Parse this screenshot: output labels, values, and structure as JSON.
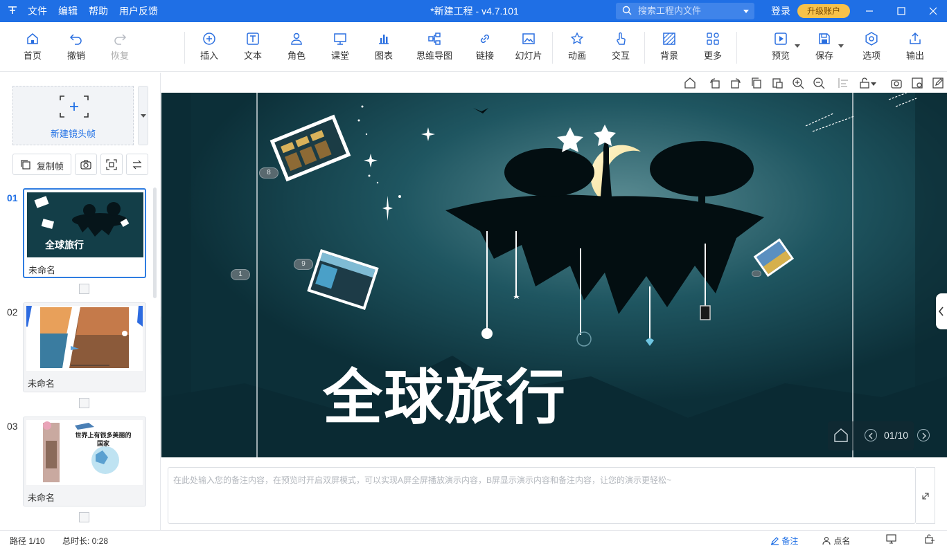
{
  "app": {
    "title": "*新建工程 - v4.7.101",
    "menu": [
      "文件",
      "编辑",
      "帮助",
      "用户反馈"
    ],
    "search_placeholder": "搜索工程内文件",
    "login": "登录",
    "upgrade": "升级账户",
    "accent": "#1f6fe5"
  },
  "toolbar": {
    "home": "首页",
    "undo": "撤销",
    "redo": "恢复",
    "insert": "插入",
    "text": "文本",
    "role": "角色",
    "lesson": "课堂",
    "chart": "图表",
    "mindmap": "思维导图",
    "link": "链接",
    "slides": "幻灯片",
    "animation": "动画",
    "interaction": "交互",
    "background": "背景",
    "more": "更多",
    "preview": "预览",
    "save": "保存",
    "options": "选项",
    "export": "输出"
  },
  "sidebar": {
    "new_frame": "新建镜头帧",
    "copy_frame": "复制帧",
    "frames": [
      {
        "num": "01",
        "name": "未命名",
        "thumb_text": "全球旅行"
      },
      {
        "num": "02",
        "name": "未命名"
      },
      {
        "num": "03",
        "name": "未命名",
        "thumb_text": "世界上有很多美丽的国家"
      }
    ]
  },
  "canvas": {
    "title": "全球旅行",
    "page": "01/10",
    "badges": [
      "8",
      "9",
      "1"
    ]
  },
  "notes": {
    "placeholder": "在此处输入您的备注内容，在预览时开启双屏模式，可以实现A屏全屏播放演示内容，B屏显示演示内容和备注内容，让您的演示更轻松~"
  },
  "status": {
    "path": "路径 1/10",
    "duration": "总时长: 0:28",
    "notes": "备注",
    "rollcall": "点名"
  }
}
